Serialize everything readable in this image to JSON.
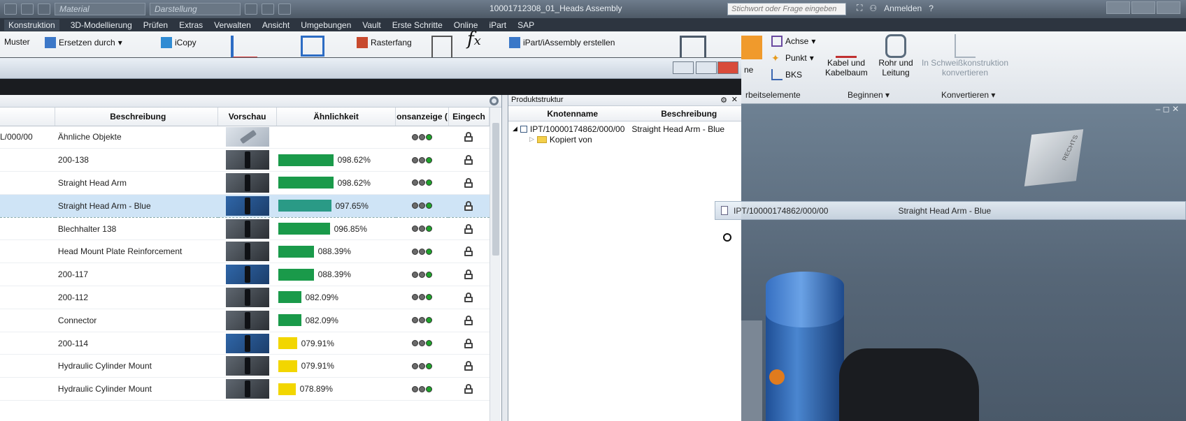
{
  "titlebar": {
    "material_combo": "Material",
    "display_combo": "Darstellung",
    "document_title": "10001712308_01_Heads Assembly",
    "search_placeholder": "Stichwort oder Frage eingeben",
    "login_label": "Anmelden"
  },
  "menu": [
    "Konstruktion",
    "3D-Modellierung",
    "Prüfen",
    "Extras",
    "Verwalten",
    "Ansicht",
    "Umgebungen",
    "Vault",
    "Erste Schritte",
    "Online",
    "iPart",
    "SAP"
  ],
  "ribbon": {
    "muster": "Muster",
    "ersetzen": "Ersetzen durch",
    "icopy": "iCopy",
    "rasterfang": "Rasterfang",
    "ipart": "iPart/iAssembly erstellen",
    "achse": "Achse",
    "punkt": "Punkt",
    "bks": "BKS",
    "kabel_1": "Kabel und",
    "kabel_2": "Kabelbaum",
    "rohr_1": "Rohr und",
    "rohr_2": "Leitung",
    "schweiss_1": "In Schweißkonstruktion",
    "schweiss_2": "konvertieren",
    "group_arbeitselemente": "rbeitselemente",
    "group_beginnen": "Beginnen",
    "group_konvertieren": "Konvertieren",
    "ne_label": "ne"
  },
  "grid": {
    "headers": {
      "beschreibung": "Beschreibung",
      "vorschau": "Vorschau",
      "aehnlichkeit": "Ähnlichkeit",
      "status": "onsanzeige (",
      "eingecheckt": "Eingech"
    },
    "rows": [
      {
        "id": "L/000/00",
        "desc": "Ähnliche Objekte",
        "pct": "",
        "bar": 0,
        "color": "#1a9a4a",
        "thumb": "light"
      },
      {
        "id": "",
        "desc": "200-138",
        "pct": "098.62%",
        "bar": 98.62,
        "color": "#1a9a4a",
        "thumb": "dark"
      },
      {
        "id": "",
        "desc": "Straight Head Arm",
        "pct": "098.62%",
        "bar": 98.62,
        "color": "#1a9a4a",
        "thumb": "dark"
      },
      {
        "id": "",
        "desc": "Straight Head Arm - Blue",
        "pct": "097.65%",
        "bar": 97.65,
        "color": "#2a9a86",
        "thumb": "blue"
      },
      {
        "id": "",
        "desc": "Blechhalter 138",
        "pct": "096.85%",
        "bar": 96.85,
        "color": "#1a9a4a",
        "thumb": "dark"
      },
      {
        "id": "",
        "desc": "Head Mount Plate Reinforcement",
        "pct": "088.39%",
        "bar": 88.39,
        "color": "#1a9a4a",
        "thumb": "dark"
      },
      {
        "id": "",
        "desc": "200-117",
        "pct": "088.39%",
        "bar": 88.39,
        "color": "#1a9a4a",
        "thumb": "blue"
      },
      {
        "id": "",
        "desc": "200-112",
        "pct": "082.09%",
        "bar": 82.09,
        "color": "#1a9a4a",
        "thumb": "dark"
      },
      {
        "id": "",
        "desc": "Connector",
        "pct": "082.09%",
        "bar": 82.09,
        "color": "#1a9a4a",
        "thumb": "dark"
      },
      {
        "id": "",
        "desc": "200-114",
        "pct": "079.91%",
        "bar": 79.91,
        "color": "#f2d600",
        "thumb": "blue"
      },
      {
        "id": "",
        "desc": "Hydraulic Cylinder Mount",
        "pct": "079.91%",
        "bar": 79.91,
        "color": "#f2d600",
        "thumb": "dark"
      },
      {
        "id": "",
        "desc": "Hydraulic Cylinder Mount",
        "pct": "078.89%",
        "bar": 78.89,
        "color": "#f2d600",
        "thumb": "dark"
      }
    ]
  },
  "produkt": {
    "title": "Produktstruktur",
    "col_knoten": "Knotenname",
    "col_beschreibung": "Beschreibung",
    "root_node": "IPT/10000174862/000/00",
    "root_desc": "Straight Head Arm - Blue",
    "child_node": "Kopiert von"
  },
  "drag": {
    "node": "IPT/10000174862/000/00",
    "desc": "Straight Head Arm - Blue"
  },
  "viewcube": {
    "label": "RECHTS"
  }
}
